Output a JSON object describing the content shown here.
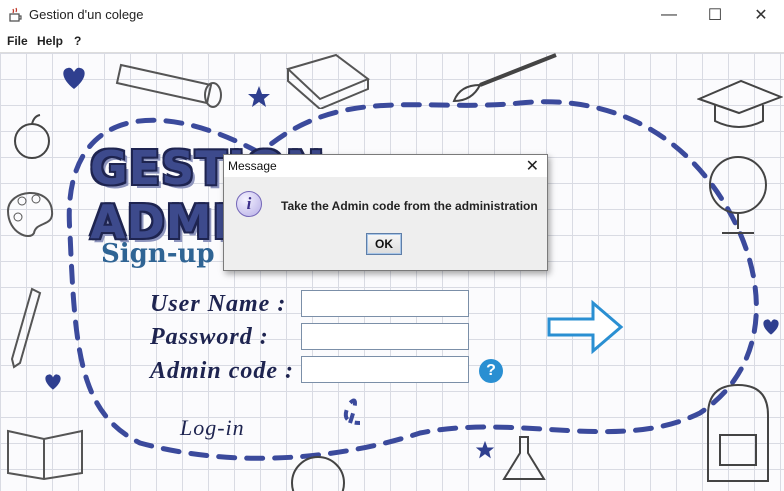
{
  "window": {
    "title": "Gestion d'un colege",
    "minimize": "—",
    "maximize": "☐",
    "close": "✕"
  },
  "menu": {
    "items": [
      "File",
      "Help",
      "?"
    ]
  },
  "form": {
    "heading": "GESTION ADMINISTRATIVE",
    "signup": "Sign-up ...",
    "username_label": "User Name :",
    "password_label": "Password :",
    "admincode_label": "Admin code :",
    "username_value": "",
    "password_value": "",
    "admincode_value": "",
    "help_glyph": "?",
    "login_label": "Log-in"
  },
  "dialog": {
    "title": "Message",
    "close": "✕",
    "icon_glyph": "i",
    "message": "Take the Admin code from the administration",
    "ok_label": "OK"
  },
  "colors": {
    "accent": "#2a8fd2",
    "ink": "#1e2450",
    "title": "#3d4a8c",
    "signup": "#2f6494"
  }
}
